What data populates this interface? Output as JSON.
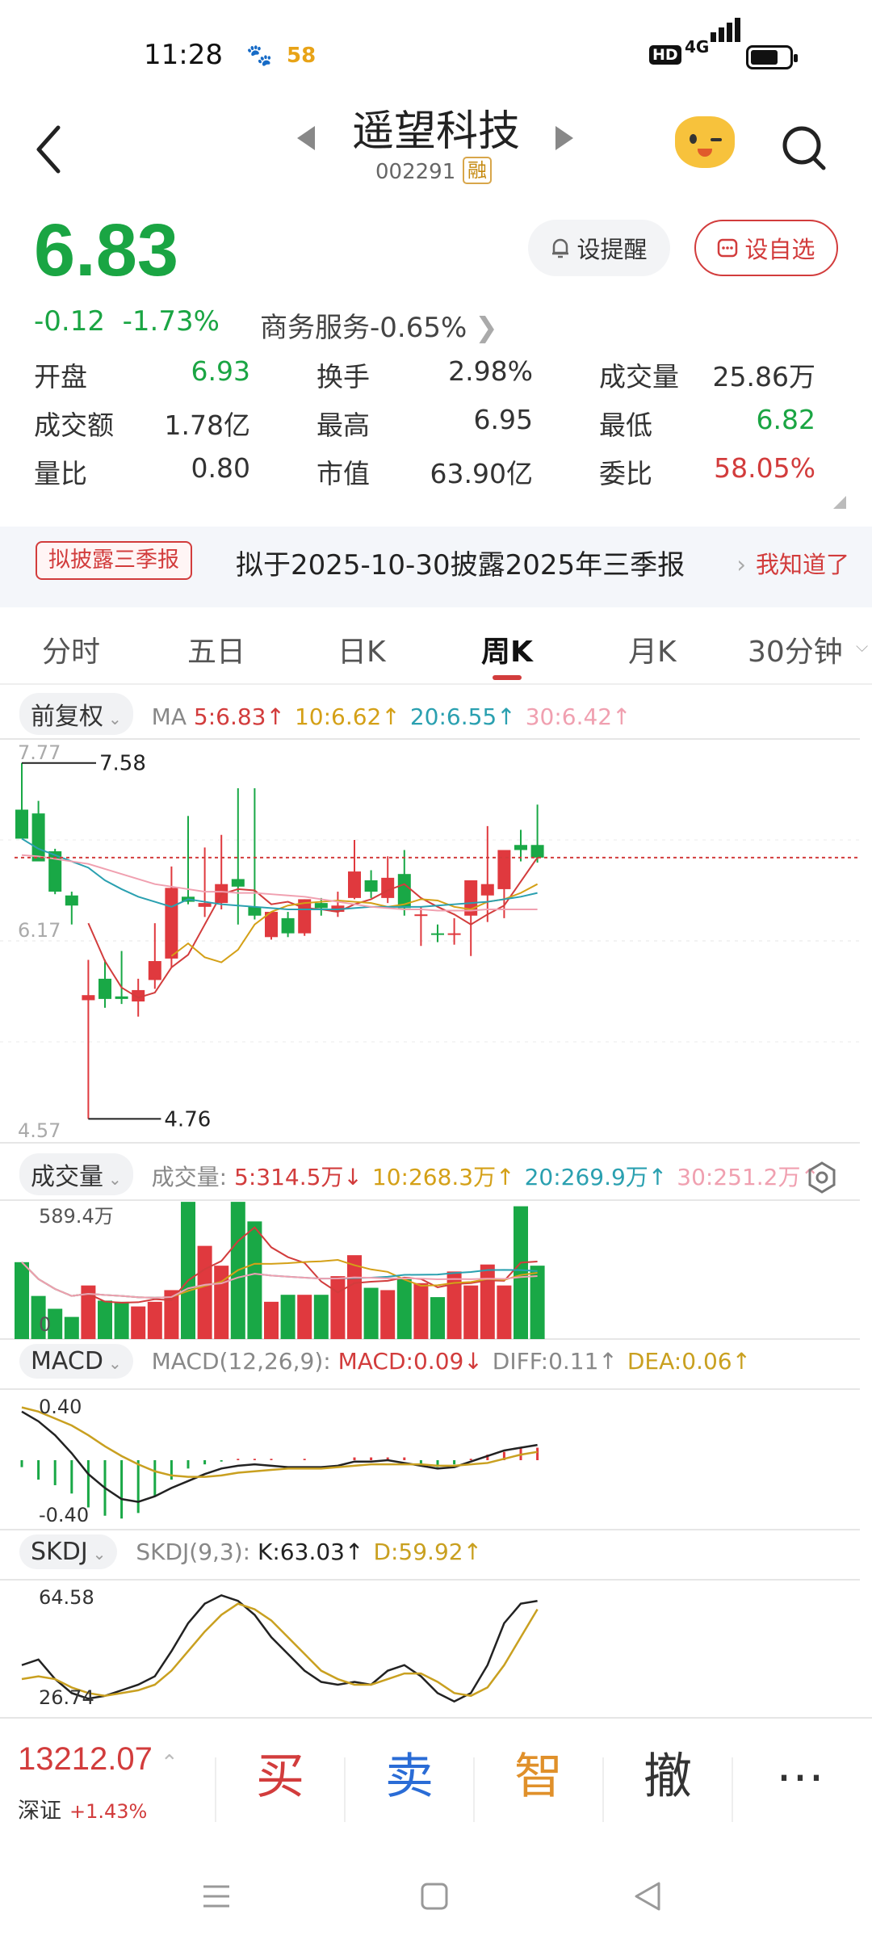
{
  "status_bar": {
    "time": "11:28",
    "app_icon_2": "58",
    "hd": "HD",
    "network": "4G",
    "battery_level": 0.72
  },
  "header": {
    "title": "遥望科技",
    "code": "002291",
    "margin_tag": "融"
  },
  "quote": {
    "price": "6.83",
    "change": "-0.12",
    "change_pct": "-1.73%",
    "sector": "商务服务-0.65%",
    "remind_label": "设提醒",
    "fav_label": "设自选",
    "stats": [
      {
        "label": "开盘",
        "value": "6.93",
        "color": "#1aa543"
      },
      {
        "label": "换手",
        "value": "2.98%",
        "color": "#333333"
      },
      {
        "label": "成交量",
        "value": "25.86万",
        "color": "#333333"
      },
      {
        "label": "成交额",
        "value": "1.78亿",
        "color": "#333333"
      },
      {
        "label": "最高",
        "value": "6.95",
        "color": "#333333"
      },
      {
        "label": "最低",
        "value": "6.82",
        "color": "#1aa543"
      },
      {
        "label": "量比",
        "value": "0.80",
        "color": "#333333"
      },
      {
        "label": "市值",
        "value": "63.90亿",
        "color": "#333333"
      },
      {
        "label": "委比",
        "value": "58.05%",
        "color": "#d23c3c"
      }
    ]
  },
  "banner": {
    "tag": "拟披露三季报",
    "message": "拟于2025-10-30披露2025年三季报",
    "action": "我知道了"
  },
  "tabs": [
    {
      "label": "分时",
      "active": false
    },
    {
      "label": "五日",
      "active": false
    },
    {
      "label": "日K",
      "active": false
    },
    {
      "label": "周K",
      "active": true
    },
    {
      "label": "月K",
      "active": false
    },
    {
      "label": "30分钟",
      "active": false
    }
  ],
  "kline": {
    "adjust_label": "前复权",
    "ma_label": "MA",
    "ma": [
      {
        "text": "5:6.83↑",
        "color": "#d23c3c"
      },
      {
        "text": "10:6.62↑",
        "color": "#d4a017"
      },
      {
        "text": "20:6.55↑",
        "color": "#2aa0b0"
      },
      {
        "text": "30:6.42↑",
        "color": "#f0a0b0"
      }
    ],
    "axis_top": "7.77",
    "axis_mid": "6.17",
    "axis_bottom": "4.57",
    "high_label": "7.58",
    "low_label": "4.76"
  },
  "volume": {
    "label": "成交量",
    "prefix": "成交量:",
    "ma": [
      {
        "text": "5:314.5万↓",
        "color": "#d23c3c"
      },
      {
        "text": "10:268.3万↑",
        "color": "#d4a017"
      },
      {
        "text": "20:269.9万↑",
        "color": "#2aa0b0"
      },
      {
        "text": "30:251.2万↑",
        "color": "#f0a0b0"
      }
    ],
    "axis_top": "589.4万",
    "axis_bottom": "0"
  },
  "macd": {
    "label": "MACD",
    "params": "MACD(12,26,9):",
    "values": [
      {
        "text": "MACD:0.09↓",
        "color": "#d23c3c"
      },
      {
        "text": "DIFF:0.11↑",
        "color": "#888888"
      },
      {
        "text": "DEA:0.06↑",
        "color": "#c9a020"
      }
    ],
    "axis_top": "0.40",
    "axis_bottom": "-0.40"
  },
  "skdj": {
    "label": "SKDJ",
    "params": "SKDJ(9,3):",
    "values": [
      {
        "text": "K:63.03↑",
        "color": "#222222"
      },
      {
        "text": "D:59.92↑",
        "color": "#c9a020"
      }
    ],
    "axis_top": "64.58",
    "axis_bottom": "26.74"
  },
  "chart_data": {
    "type": "candlestick",
    "candles": [
      {
        "o": 7.21,
        "c": 6.98,
        "h": 7.58,
        "l": 7.0
      },
      {
        "o": 7.18,
        "c": 6.8,
        "h": 7.28,
        "l": 6.82
      },
      {
        "o": 6.88,
        "c": 6.56,
        "h": 6.9,
        "l": 6.54
      },
      {
        "o": 6.53,
        "c": 6.45,
        "h": 6.56,
        "l": 6.3
      },
      {
        "o": 5.7,
        "c": 5.74,
        "h": 6.02,
        "l": 4.76
      },
      {
        "o": 5.87,
        "c": 5.71,
        "h": 6.02,
        "l": 5.64
      },
      {
        "o": 5.73,
        "c": 5.71,
        "h": 6.09,
        "l": 5.67
      },
      {
        "o": 5.69,
        "c": 5.78,
        "h": 5.87,
        "l": 5.57
      },
      {
        "o": 5.86,
        "c": 6.01,
        "h": 6.31,
        "l": 5.79
      },
      {
        "o": 6.03,
        "c": 6.59,
        "h": 6.76,
        "l": 5.96
      },
      {
        "o": 6.52,
        "c": 6.48,
        "h": 7.16,
        "l": 6.46
      },
      {
        "o": 6.44,
        "c": 6.47,
        "h": 6.91,
        "l": 6.36
      },
      {
        "o": 6.47,
        "c": 6.62,
        "h": 7.01,
        "l": 6.42
      },
      {
        "o": 6.66,
        "c": 6.6,
        "h": 7.38,
        "l": 6.3
      },
      {
        "o": 6.44,
        "c": 6.37,
        "h": 7.38,
        "l": 6.34
      },
      {
        "o": 6.2,
        "c": 6.4,
        "h": 6.38,
        "l": 6.18
      },
      {
        "o": 6.35,
        "c": 6.23,
        "h": 6.4,
        "l": 6.2
      },
      {
        "o": 6.23,
        "c": 6.5,
        "h": 6.5,
        "l": 6.21
      },
      {
        "o": 6.47,
        "c": 6.43,
        "h": 6.51,
        "l": 6.37
      },
      {
        "o": 6.4,
        "c": 6.45,
        "h": 6.56,
        "l": 6.36
      },
      {
        "o": 6.51,
        "c": 6.72,
        "h": 6.97,
        "l": 6.5
      },
      {
        "o": 6.65,
        "c": 6.56,
        "h": 6.73,
        "l": 6.51
      },
      {
        "o": 6.51,
        "c": 6.67,
        "h": 6.84,
        "l": 6.47
      },
      {
        "o": 6.7,
        "c": 6.43,
        "h": 6.89,
        "l": 6.37
      },
      {
        "o": 6.38,
        "c": 6.38,
        "h": 6.44,
        "l": 6.13
      },
      {
        "o": 6.23,
        "c": 6.22,
        "h": 6.3,
        "l": 6.16
      },
      {
        "o": 6.22,
        "c": 6.23,
        "h": 6.35,
        "l": 6.14
      },
      {
        "o": 6.37,
        "c": 6.65,
        "h": 6.65,
        "l": 6.05
      },
      {
        "o": 6.53,
        "c": 6.62,
        "h": 7.08,
        "l": 6.32
      },
      {
        "o": 6.58,
        "c": 6.89,
        "h": 6.89,
        "l": 6.35
      },
      {
        "o": 6.93,
        "c": 6.89,
        "h": 7.05,
        "l": 6.8
      },
      {
        "o": 6.93,
        "c": 6.83,
        "h": 7.25,
        "l": 6.79
      }
    ],
    "ma_series": [
      {
        "period": 5,
        "color": "#d23c3c",
        "values": [
          null,
          null,
          null,
          null,
          6.31,
          6.01,
          5.8,
          5.72,
          5.76,
          5.96,
          6.06,
          6.3,
          6.54,
          6.58,
          6.57,
          6.46,
          6.48,
          6.43,
          6.42,
          6.4,
          6.46,
          6.5,
          6.57,
          6.62,
          6.51,
          6.44,
          6.38,
          6.3,
          6.38,
          6.45,
          6.64,
          6.83
        ]
      },
      {
        "period": 10,
        "color": "#d4a017",
        "values": [
          null,
          null,
          null,
          null,
          null,
          null,
          null,
          null,
          null,
          6.05,
          6.15,
          6.04,
          6.0,
          6.1,
          6.3,
          6.4,
          6.45,
          6.47,
          6.48,
          6.49,
          6.48,
          6.47,
          6.44,
          6.46,
          6.5,
          6.49,
          6.44,
          6.42,
          6.48,
          6.5,
          6.55,
          6.62
        ]
      },
      {
        "period": 20,
        "color": "#2aa0b0",
        "values": [
          6.98,
          6.9,
          6.85,
          6.8,
          6.75,
          6.65,
          6.58,
          6.52,
          6.48,
          6.44,
          6.5,
          6.48,
          6.46,
          6.45,
          6.44,
          6.43,
          6.42,
          6.42,
          6.42,
          6.42,
          6.43,
          6.44,
          6.44,
          6.44,
          6.44,
          6.45,
          6.46,
          6.47,
          6.48,
          6.5,
          6.52,
          6.55
        ]
      },
      {
        "period": 30,
        "color": "#f0a0b0",
        "values": [
          6.85,
          6.84,
          6.82,
          6.8,
          6.78,
          6.74,
          6.7,
          6.66,
          6.62,
          6.6,
          6.58,
          6.56,
          6.56,
          6.55,
          6.55,
          6.54,
          6.53,
          6.52,
          6.5,
          6.48,
          6.46,
          6.44,
          6.43,
          6.42,
          6.42,
          6.41,
          6.41,
          6.41,
          6.42,
          6.42,
          6.42,
          6.42
        ]
      }
    ],
    "volume_values": [
      330,
      185,
      130,
      95,
      230,
      165,
      160,
      140,
      160,
      210,
      589,
      400,
      315,
      589,
      505,
      160,
      190,
      190,
      190,
      270,
      360,
      220,
      210,
      260,
      240,
      180,
      290,
      230,
      320,
      230,
      570,
      315
    ],
    "macd_bars": [
      -0.05,
      -0.14,
      -0.18,
      -0.24,
      -0.34,
      -0.4,
      -0.42,
      -0.38,
      -0.26,
      -0.14,
      -0.06,
      -0.03,
      -0.01,
      0.01,
      0.01,
      0.01,
      0.0,
      0.01,
      0.0,
      0.0,
      0.02,
      0.02,
      0.02,
      0.02,
      -0.03,
      -0.05,
      -0.03,
      0.01,
      0.04,
      0.06,
      0.09,
      0.09
    ],
    "macd_diff": [
      0.35,
      0.28,
      0.18,
      0.05,
      -0.1,
      -0.2,
      -0.28,
      -0.3,
      -0.26,
      -0.2,
      -0.15,
      -0.1,
      -0.06,
      -0.04,
      -0.03,
      -0.04,
      -0.05,
      -0.05,
      -0.05,
      -0.04,
      -0.01,
      -0.01,
      0.0,
      -0.02,
      -0.04,
      -0.06,
      -0.05,
      -0.01,
      0.03,
      0.07,
      0.09,
      0.11
    ],
    "macd_dea": [
      0.38,
      0.35,
      0.3,
      0.25,
      0.18,
      0.1,
      0.03,
      -0.03,
      -0.08,
      -0.11,
      -0.12,
      -0.12,
      -0.11,
      -0.09,
      -0.08,
      -0.07,
      -0.06,
      -0.06,
      -0.06,
      -0.05,
      -0.04,
      -0.03,
      -0.03,
      -0.03,
      -0.03,
      -0.04,
      -0.04,
      -0.03,
      -0.02,
      0.01,
      0.04,
      0.06
    ],
    "skdj_k": [
      40,
      42,
      35,
      30,
      28,
      29,
      31,
      33,
      36,
      45,
      55,
      62,
      65,
      63,
      58,
      50,
      44,
      38,
      34,
      33,
      34,
      33,
      38,
      40,
      36,
      30,
      27,
      30,
      40,
      55,
      62,
      63
    ],
    "skdj_d": [
      35,
      36,
      35,
      32,
      30,
      29,
      30,
      31,
      33,
      38,
      45,
      52,
      58,
      62,
      60,
      56,
      50,
      44,
      38,
      35,
      33,
      33,
      35,
      37,
      37,
      34,
      30,
      29,
      32,
      40,
      50,
      60
    ]
  },
  "bottom": {
    "index_value": "13212.07",
    "index_name": "深证",
    "index_change": "+1.43%",
    "actions": [
      {
        "label": "买",
        "color": "#d23c3c"
      },
      {
        "label": "卖",
        "color": "#2a6cd6"
      },
      {
        "label": "智",
        "color": "#e0902a"
      },
      {
        "label": "撤",
        "color": "#333333"
      }
    ],
    "more": "⋯"
  }
}
